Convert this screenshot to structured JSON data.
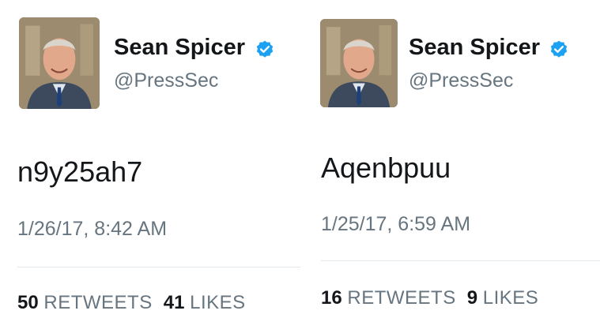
{
  "tweets": [
    {
      "display_name": "Sean Spicer",
      "handle": "@PressSec",
      "text": "n9y25ah7",
      "timestamp": "1/26/17, 8:42 AM",
      "retweets_count": "50",
      "retweets_label": "RETWEETS",
      "likes_count": "41",
      "likes_label": "LIKES"
    },
    {
      "display_name": "Sean Spicer",
      "handle": "@PressSec",
      "text": "Aqenbpuu",
      "timestamp": "1/25/17, 6:59 AM",
      "retweets_count": "16",
      "retweets_label": "RETWEETS",
      "likes_count": "9",
      "likes_label": "LIKES"
    }
  ],
  "colors": {
    "name": "#14171a",
    "secondary": "#66757f",
    "verified": "#1da1f2",
    "divider": "#e1e8ed"
  }
}
